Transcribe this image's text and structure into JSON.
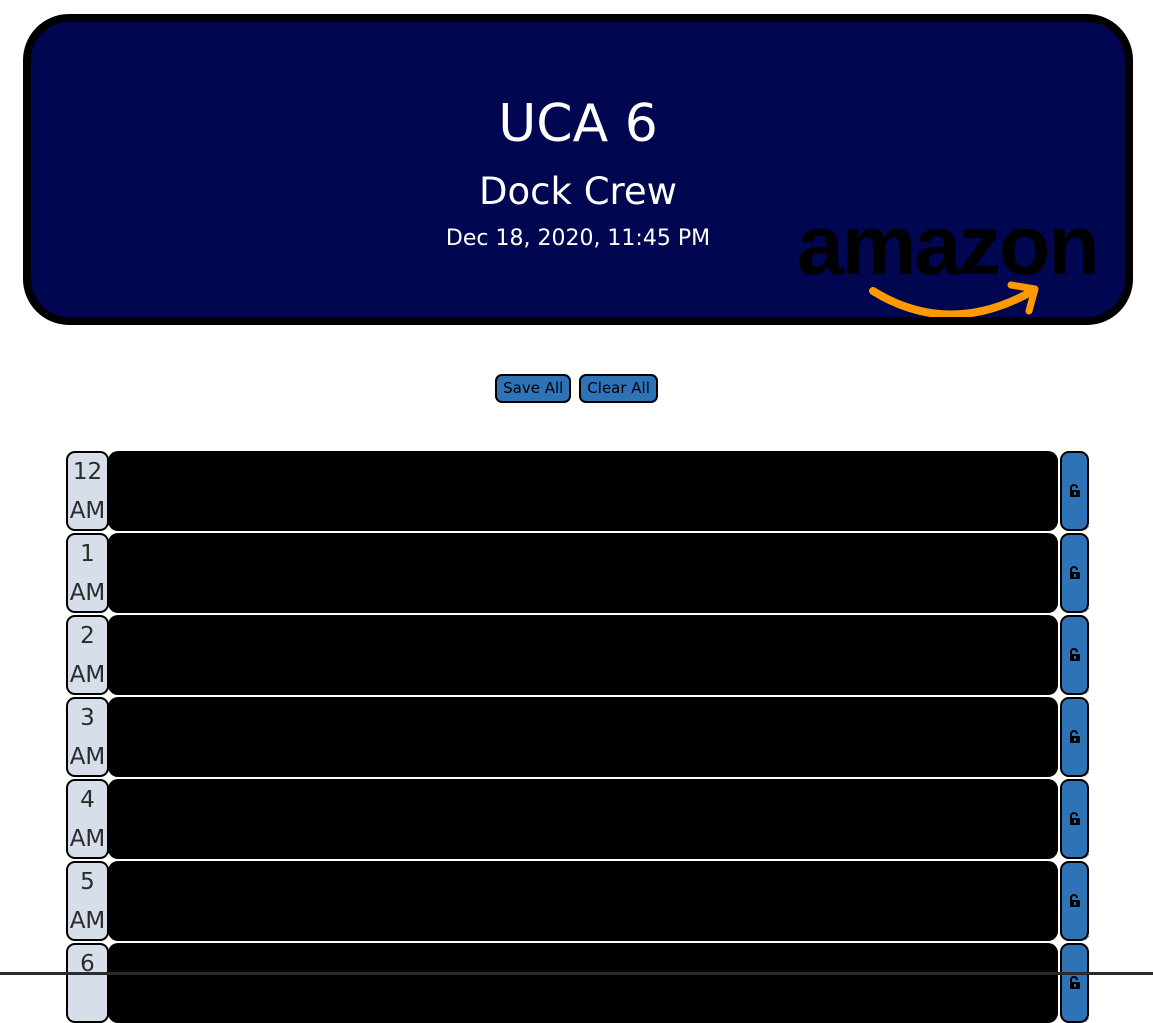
{
  "header": {
    "title": "UCA 6",
    "subtitle": "Dock Crew",
    "timestamp": "Dec 18, 2020, 11:45 PM",
    "logo_text": "amazon",
    "background_color": "#000750",
    "logo_smile_color": "#FF9900"
  },
  "toolbar": {
    "save_all_label": "Save All",
    "clear_all_label": "Clear All",
    "button_color": "#2f73b7"
  },
  "schedule": {
    "rows": [
      {
        "hour": "12",
        "period": "AM",
        "entry": "",
        "lock_icon": "lock-open-icon"
      },
      {
        "hour": "1",
        "period": "AM",
        "entry": "",
        "lock_icon": "lock-open-icon"
      },
      {
        "hour": "2",
        "period": "AM",
        "entry": "",
        "lock_icon": "lock-open-icon"
      },
      {
        "hour": "3",
        "period": "AM",
        "entry": "",
        "lock_icon": "lock-open-icon"
      },
      {
        "hour": "4",
        "period": "AM",
        "entry": "",
        "lock_icon": "lock-open-icon"
      },
      {
        "hour": "5",
        "period": "AM",
        "entry": "",
        "lock_icon": "lock-open-icon"
      },
      {
        "hour": "6",
        "period": "",
        "entry": "",
        "lock_icon": "lock-open-icon"
      }
    ]
  }
}
